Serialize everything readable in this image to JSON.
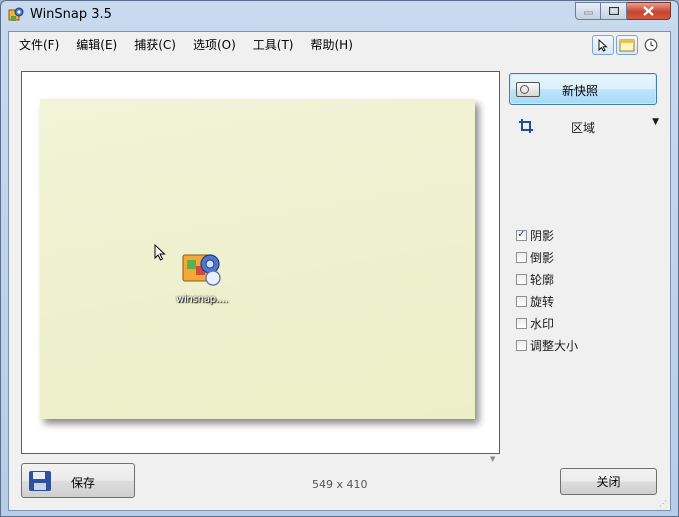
{
  "window": {
    "title": "WinSnap 3.5",
    "icon": "winsnap-app-icon",
    "controls": [
      "minimize-icon",
      "maximize-icon",
      "close-icon"
    ]
  },
  "menu": [
    "文件(F)",
    "编辑(E)",
    "捕获(C)",
    "选项(O)",
    "工具(T)",
    "帮助(H)"
  ],
  "mode_icons": [
    "pointer-icon",
    "window-capture-icon",
    "clock-icon"
  ],
  "preview": {
    "desktop_icon_label": "winsnap...."
  },
  "sidebar": {
    "new_snapshot_label": "新快照",
    "region_label": "区域",
    "options": [
      {
        "label": "阴影",
        "checked": true
      },
      {
        "label": "倒影",
        "checked": false
      },
      {
        "label": "轮廓",
        "checked": false
      },
      {
        "label": "旋转",
        "checked": false
      },
      {
        "label": "水印",
        "checked": false
      },
      {
        "label": "调整大小",
        "checked": false
      }
    ]
  },
  "footer": {
    "save_label": "保存",
    "dimensions": "549 x 410",
    "close_label": "关闭"
  },
  "colors": {
    "accent": "#3c7fb1",
    "capture_bg": "#eef0cf",
    "close_button": "#c7442e"
  }
}
